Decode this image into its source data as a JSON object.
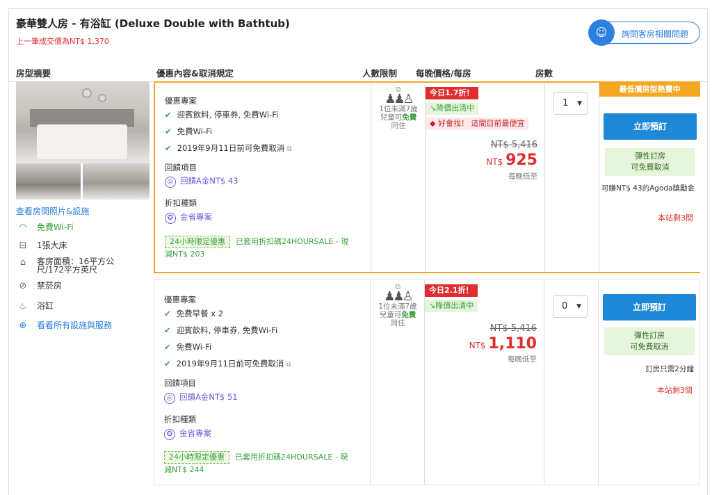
{
  "room": {
    "title": "豪華雙人房 - 有浴缸 (Deluxe Double with Bathtub)",
    "last_price": "上一筆成交價為NT$ 1,370",
    "ask_label": "詢問客房相關問題"
  },
  "headers": {
    "summary": "房型摘要",
    "offer": "優惠內容&取消規定",
    "people": "人數限制",
    "price": "每晚價格/每房",
    "rooms": "房數"
  },
  "summary": {
    "photo_link": "查看房間照片&設施",
    "features": [
      "免費Wi-Fi",
      "1張大床",
      "客房面積：16平方公尺/172平方英尺",
      "禁菸房",
      "浴缸"
    ],
    "all_facilities": "看看所有設施與服務"
  },
  "offers": [
    {
      "deal_title": "優惠專案",
      "items": [
        "迎賓飲料, 停車券, 免費Wi-Fi",
        "免費Wi-Fi",
        "2019年9月11日前可免費取消"
      ],
      "rebate_title": "回饋項目",
      "rebate": "回饋A金NT$ 43",
      "discount_title": "折扣種類",
      "discount": "金省專案",
      "promo_tag": "24小時限定優惠",
      "promo_text": "已套用折扣碼24HOURSALE - 現減NT$ 203",
      "people_line1": "1位未滿7歲",
      "people_line2a": "兒童可",
      "people_free": "免費",
      "people_line3": "同住",
      "disc_badge": "今日1.7折！",
      "drop_badge": "↘降價出清中",
      "good_badge": "好會找！ 這間目前最便宜",
      "was_price": "NT$ 5,416",
      "currency": "NT$",
      "price": "925",
      "per_night": "每晚低至",
      "qty": "1",
      "hot_label": "最低價房型熱賣中",
      "book_label": "立即預訂",
      "flex_line1": "彈性訂房",
      "flex_line2": "可免費取消",
      "note": "可賺NT$ 43的Agoda獎勵金",
      "remaining": "本站剩3間"
    },
    {
      "deal_title": "優惠專案",
      "items": [
        "免費早餐 x 2",
        "迎賓飲料, 停車券, 免費Wi-Fi",
        "免費Wi-Fi",
        "2019年9月11日前可免費取消"
      ],
      "rebate_title": "回饋項目",
      "rebate": "回饋A金NT$ 51",
      "discount_title": "折扣種類",
      "discount": "金省專案",
      "promo_tag": "24小時限定優惠",
      "promo_text": "已套用折扣碼24HOURSALE - 現減NT$ 244",
      "people_line1": "1位未滿7歲",
      "people_line2a": "兒童可",
      "people_free": "免費",
      "people_line3": "同住",
      "disc_badge": "今日2.1折！",
      "drop_badge": "↘降價出清中",
      "was_price": "NT$ 5,416",
      "currency": "NT$",
      "price": "1,110",
      "per_night": "每晚低至",
      "qty": "0",
      "book_label": "立即預訂",
      "flex_line1": "彈性訂房",
      "flex_line2": "可免費取消",
      "note": "訂房只需2分鐘",
      "remaining": "本站剩3間"
    }
  ],
  "colors": {
    "accent": "#1e88d8",
    "highlight_border": "#f5a623",
    "price_red": "#e12d2d",
    "green": "#38a13b"
  }
}
